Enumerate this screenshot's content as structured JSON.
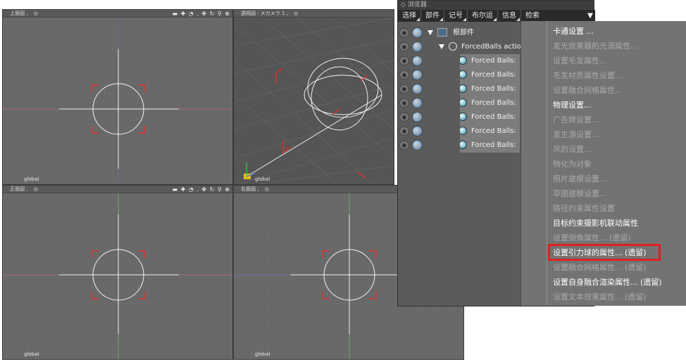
{
  "viewports": {
    "top": {
      "title": "上面図 ,",
      "label": "global"
    },
    "perspective": {
      "title": "透視図 : メカメラ 1 ,",
      "label": "global"
    },
    "front": {
      "title": "正面図 ,",
      "label": "global"
    },
    "right": {
      "title": "右面図 ,",
      "label": "global"
    },
    "tools_label": "▬ ✚ ◔ . ✥ ↻ ⚲ ⊕"
  },
  "browser": {
    "title": "浏览器",
    "menu": [
      {
        "label": "选择"
      },
      {
        "label": "部件"
      },
      {
        "label": "记号"
      },
      {
        "label": "布尔运"
      },
      {
        "label": "信息"
      },
      {
        "label": "检索"
      }
    ],
    "dropdown_glyph": "▼",
    "tree": {
      "root": "根部件",
      "action": "ForcedBalls actio",
      "children": [
        "Forced Balls:",
        "Forced Balls:",
        "Forced Balls:",
        "Forced Balls:",
        "Forced Balls:",
        "Forced Balls:",
        "Forced Balls:"
      ]
    }
  },
  "context_menu": {
    "items": [
      {
        "label": "卡通设置 ...",
        "enabled": true
      },
      {
        "label": "发光效果器的光源属性...",
        "enabled": false
      },
      {
        "label": "设置毛发属性...",
        "enabled": false
      },
      {
        "label": "毛发材质属性设置...",
        "enabled": false
      },
      {
        "label": "设置融合网格属性...",
        "enabled": false
      },
      {
        "label": "物理设置...",
        "enabled": true
      },
      {
        "label": "广告牌设置...",
        "enabled": false
      },
      {
        "label": "发生源设置...",
        "enabled": false
      },
      {
        "label": "风的设置...",
        "enabled": false
      },
      {
        "label": "物化为对象",
        "enabled": false
      },
      {
        "label": "照片建模设置...",
        "enabled": false
      },
      {
        "label": "草图建模设置...",
        "enabled": false
      },
      {
        "label": "路径约束属性设置",
        "enabled": false
      },
      {
        "label": "目标约束摄影机联动属性",
        "enabled": true
      },
      {
        "label": "设置倒角属性... (遗留)",
        "enabled": false
      },
      {
        "label": "设置引力球的属性... (遗留)",
        "enabled": true
      },
      {
        "label": "设置融合网格属性... (遗留)",
        "enabled": false
      },
      {
        "label": "设置自身融合渲染属性... (遗留)",
        "enabled": true
      },
      {
        "label": "设置文本效果属性... (遗留)",
        "enabled": false
      }
    ]
  },
  "colors": {
    "highlight": "#e02020",
    "grid": "#7a7a7a",
    "viewport_bg": "#686868"
  }
}
